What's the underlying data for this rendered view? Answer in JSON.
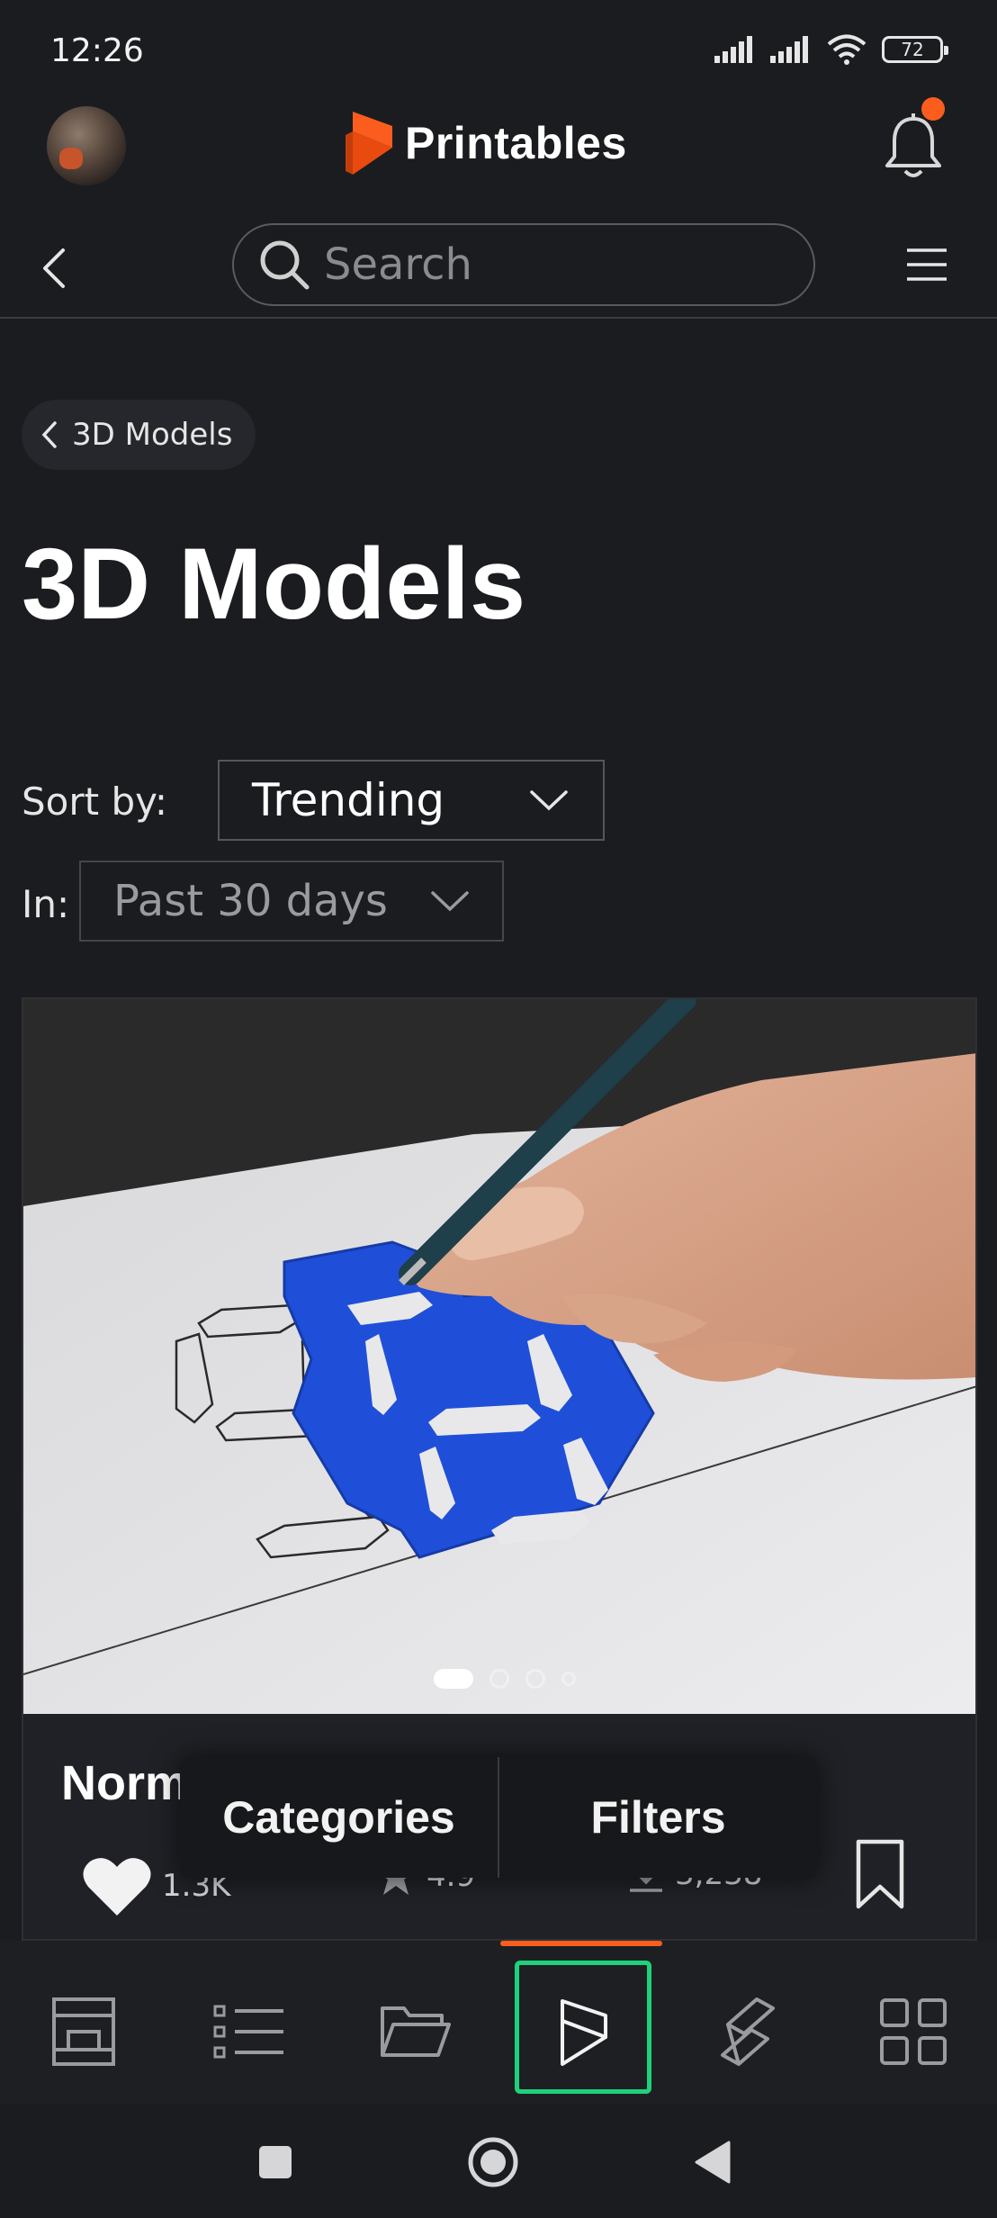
{
  "status_bar": {
    "time": "12:26",
    "battery": "72"
  },
  "header": {
    "brand": "Printables"
  },
  "search": {
    "placeholder": "Search"
  },
  "breadcrumb": {
    "label": "3D Models"
  },
  "page": {
    "title": "3D Models"
  },
  "sort": {
    "label": "Sort by:",
    "value": "Trending"
  },
  "period": {
    "label": "In:",
    "value": "Past 30 days"
  },
  "model_card": {
    "title": "Norm",
    "likes": "1.3K",
    "rating": "4.9",
    "downloads": "3,238",
    "carousel_total": 4,
    "carousel_index": 1
  },
  "floating_bar": {
    "categories": "Categories",
    "filters": "Filters"
  },
  "colors": {
    "accent": "#fa5d1e",
    "background": "#1b1c20",
    "selected_outline": "#1fd17a",
    "model_blue": "#1f4fd8"
  },
  "bottom_nav": {
    "items": [
      {
        "icon": "printer-icon"
      },
      {
        "icon": "list-icon"
      },
      {
        "icon": "folder-icon"
      },
      {
        "icon": "printables-logo-icon",
        "selected": true
      },
      {
        "icon": "layers-icon"
      },
      {
        "icon": "grid-icon"
      }
    ]
  }
}
